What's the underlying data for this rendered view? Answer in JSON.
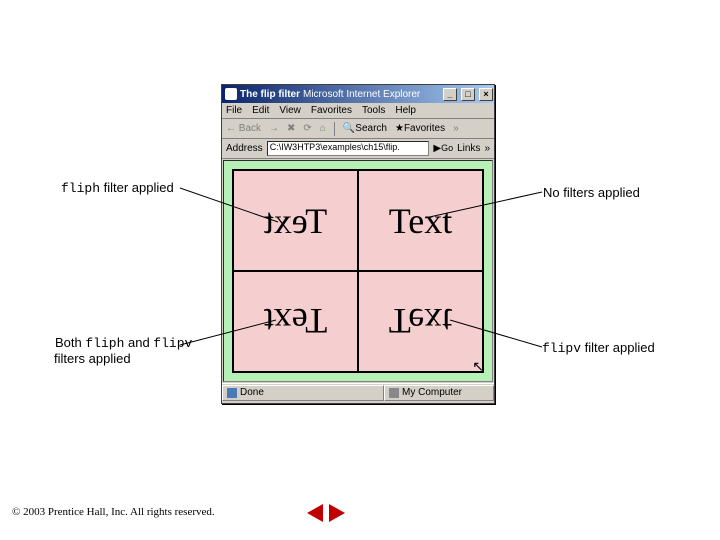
{
  "window": {
    "title_page": "The flip filter",
    "title_app": "Microsoft Internet Explorer",
    "btn_min": "_",
    "btn_max": "□",
    "btn_close": "×"
  },
  "menubar": [
    "File",
    "Edit",
    "View",
    "Favorites",
    "Tools",
    "Help"
  ],
  "toolbar": {
    "back": "Back",
    "search": "Search",
    "favorites": "Favorites",
    "more": "»"
  },
  "address": {
    "label": "Address",
    "value": "C:\\IW3HTP3\\examples\\ch15\\flip.",
    "go": "Go",
    "links": "Links",
    "more": "»"
  },
  "cells": {
    "tl": "Text",
    "tr": "Text",
    "bl": "Text",
    "br": "Text"
  },
  "status": {
    "left": "Done",
    "right": "My Computer"
  },
  "callouts": {
    "no_filters": "No filters applied",
    "fliph_pre": "fliph",
    "fliph_post": " filter applied",
    "flipv_pre": "flipv",
    "flipv_post": " filter applied",
    "both_pre": "Both ",
    "both_mid1": "fliph",
    "both_mid2": " and ",
    "both_mid3": "flipv",
    "both_post": " filters applied"
  },
  "footer": {
    "copyright": "© 2003 Prentice Hall, Inc.  All rights reserved."
  }
}
